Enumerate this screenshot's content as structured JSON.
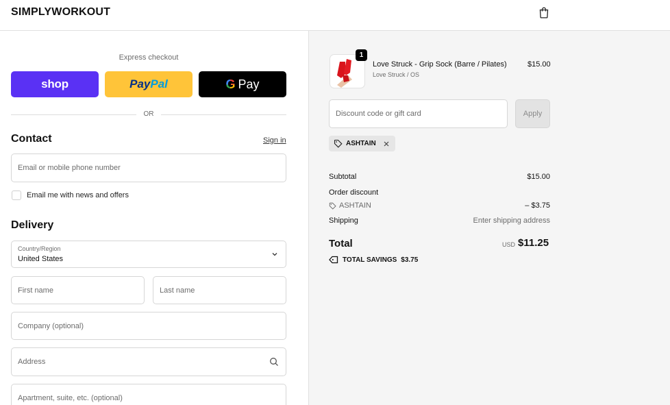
{
  "header": {
    "brand": "SIMPLYWORKOUT",
    "cart_icon": "shopping-bag-icon"
  },
  "express": {
    "title": "Express checkout",
    "shop_label": "shop",
    "paypal_label_1": "Pay",
    "paypal_label_2": "Pal",
    "gpay_g": "G",
    "gpay_label": "Pay",
    "or_label": "OR"
  },
  "contact": {
    "title": "Contact",
    "sign_in": "Sign in",
    "email_placeholder": "Email or mobile phone number",
    "news_label": "Email me with news and offers"
  },
  "delivery": {
    "title": "Delivery",
    "country_label": "Country/Region",
    "country_value": "United States",
    "first_name_placeholder": "First name",
    "last_name_placeholder": "Last name",
    "company_placeholder": "Company (optional)",
    "address_placeholder": "Address",
    "apartment_placeholder": "Apartment, suite, etc. (optional)"
  },
  "order": {
    "quantity": "1",
    "product_name": "Love Struck - Grip Sock (Barre / Pilates)",
    "product_variant": "Love Struck / OS",
    "product_price": "$15.00",
    "discount_placeholder": "Discount code or gift card",
    "apply_label": "Apply",
    "code_chip": "ASHTAIN",
    "subtotal_label": "Subtotal",
    "subtotal_value": "$15.00",
    "order_discount_label": "Order discount",
    "discount_code": "ASHTAIN",
    "discount_value": "– $3.75",
    "shipping_label": "Shipping",
    "shipping_value": "Enter shipping address",
    "total_label": "Total",
    "total_currency": "USD",
    "total_value": "$11.25",
    "savings_label": "TOTAL SAVINGS",
    "savings_value": "$3.75"
  },
  "colors": {
    "shop": "#5a31f4",
    "paypal": "#ffc439",
    "gpay": "#000000",
    "summary_bg": "#f5f5f5"
  }
}
